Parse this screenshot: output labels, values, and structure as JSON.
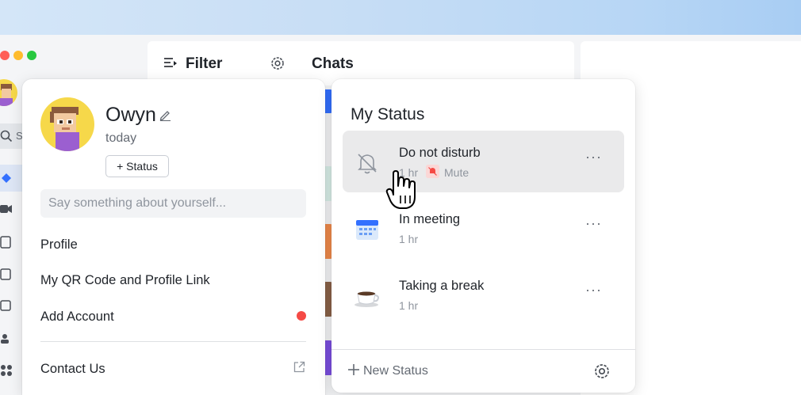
{
  "filter_bar": {
    "label": "Filter",
    "icon": "filter-icon",
    "settings_icon": "gear-icon"
  },
  "chats_bar": {
    "label": "Chats"
  },
  "left_rail": {
    "search_partial": "S"
  },
  "profile": {
    "name": "Owyn",
    "last_seen": "today",
    "status_button": "+ Status",
    "about_placeholder": "Say something about yourself...",
    "menu": [
      {
        "label": "Profile"
      },
      {
        "label": "My QR Code and Profile Link"
      },
      {
        "label": "Add Account",
        "has_notification_dot": true
      },
      {
        "label": "Contact Us",
        "icon": "external-link-icon"
      }
    ],
    "avatar_colors": {
      "bg": "#f6d84a",
      "hair": "#8b5a3c",
      "shirt": "#9b5fd0"
    }
  },
  "my_status": {
    "title": "My Status",
    "items": [
      {
        "title": "Do not disturb",
        "duration": "1 hr",
        "extra": "Mute",
        "icon": "bell-off-icon",
        "hovered": true
      },
      {
        "title": "In meeting",
        "duration": "1 hr",
        "icon": "calendar-icon"
      },
      {
        "title": "Taking a break",
        "duration": "1 hr",
        "icon": "coffee-cup-icon"
      }
    ],
    "more_label": "···",
    "new_status_label": "New Status",
    "settings_icon": "gear-icon"
  },
  "colors": {
    "accent": "#3370ff",
    "red_dot": "#f54a45",
    "hover_row": "#eaeaeb"
  }
}
